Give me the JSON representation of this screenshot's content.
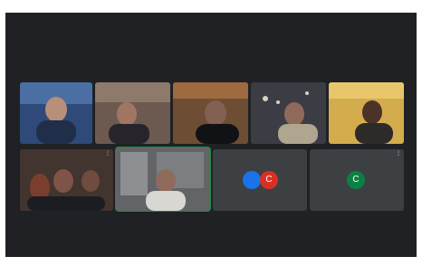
{
  "meeting": {
    "accent_active": "#1e8e3e",
    "tiles": [
      {
        "name": "",
        "menu": ""
      },
      {
        "name": "",
        "menu": ""
      },
      {
        "name": "",
        "menu": ""
      },
      {
        "name": "",
        "menu": ""
      },
      {
        "name": "",
        "menu": ""
      },
      {
        "name": "",
        "menu": "⋮"
      },
      {
        "name": "",
        "menu": ""
      },
      {
        "name": "",
        "menu": "",
        "avatars": [
          "",
          "C"
        ],
        "avatar_colors": [
          "#1a73e8",
          "#d93025"
        ]
      },
      {
        "name": "",
        "menu": "⋮",
        "avatars": [
          "C"
        ],
        "avatar_colors": [
          "#0b8043"
        ]
      }
    ]
  }
}
